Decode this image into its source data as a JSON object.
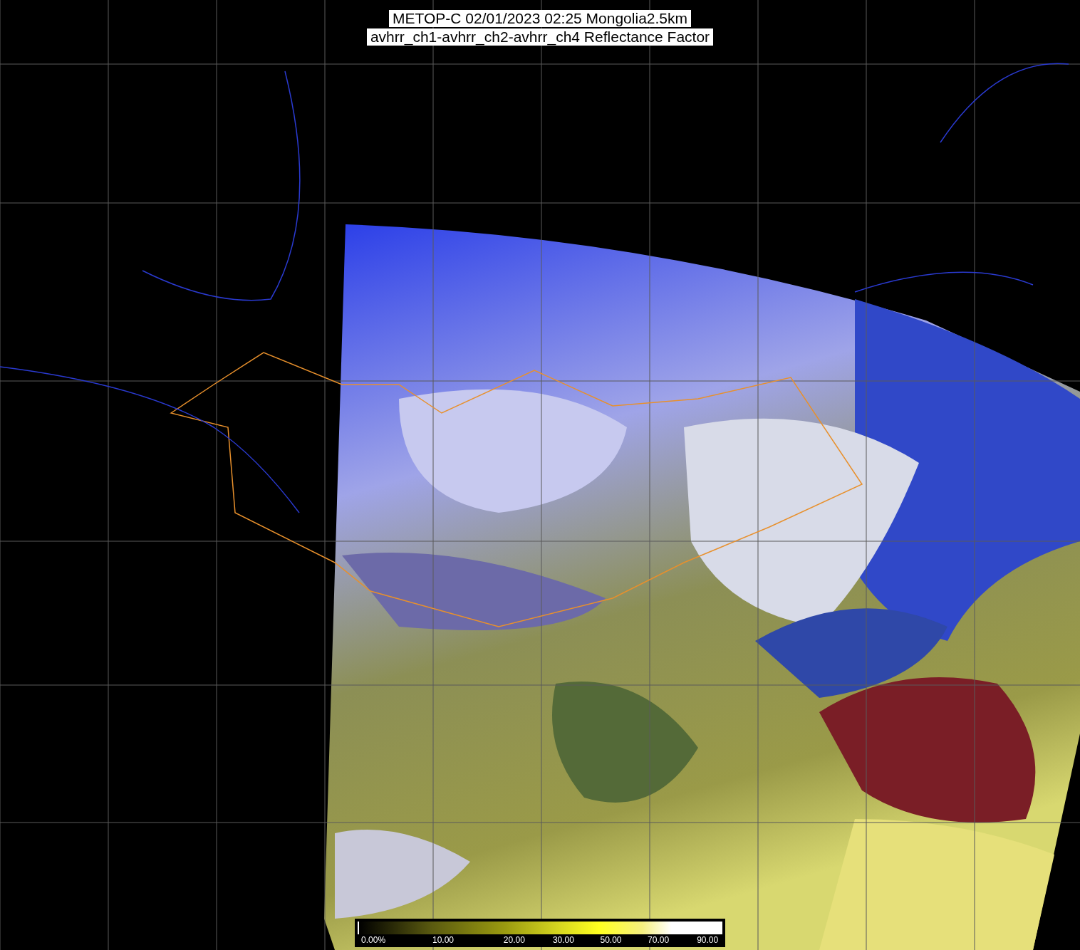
{
  "title": {
    "lines": [
      "METOP-C 02/01/2023 02:25 Mongolia2.5km",
      "avhrr_ch1-avhrr_ch2-avhrr_ch4 Reflectance Factor"
    ]
  },
  "colorbar": {
    "labels": [
      "0.00%",
      "10.00",
      "20.00",
      "30.00",
      "50.00",
      "70.00",
      "90.00"
    ]
  }
}
